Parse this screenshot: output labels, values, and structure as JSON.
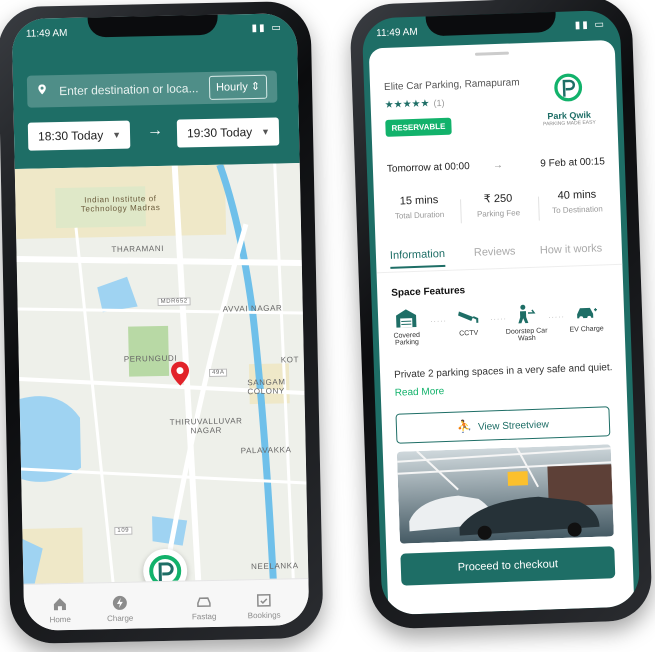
{
  "colors": {
    "brand": "#1e6e66",
    "accent_green": "#12b26b",
    "map_road": "#ffffff",
    "water": "#9fd3f2"
  },
  "phone_left": {
    "status_time": "11:49 AM",
    "search": {
      "placeholder": "Enter destination or loca...",
      "mode": "Hourly"
    },
    "start_time": "18:30 Today",
    "end_time": "19:30 Today",
    "arrow": "→",
    "map_labels": [
      "Indian Institute of Technology Madras",
      "THARAMANI",
      "PERUNGUDI",
      "AVVAI NAGAR",
      "SANGAM COLONY",
      "THIRUVALLUVAR NAGAR",
      "PALAVAKKA",
      "NEELANKA",
      "KOT",
      "MDR652",
      "109",
      "49A"
    ],
    "tabs": [
      {
        "label": "Home",
        "icon": "home-icon"
      },
      {
        "label": "Charge",
        "icon": "charge-icon"
      },
      {
        "label": "Fastag",
        "icon": "car-icon"
      },
      {
        "label": "Bookings",
        "icon": "calendar-check-icon"
      }
    ]
  },
  "phone_right": {
    "status_time": "11:49 AM",
    "title": "Elite Car Parking, Ramapuram",
    "rating_count": "(1)",
    "badge": "RESERVABLE",
    "brand": {
      "name": "Park Qwik",
      "tagline": "PARKING MADE EASY"
    },
    "from": "Tomorrow at 00:00",
    "to": "9 Feb at 00:15",
    "stats": [
      {
        "value": "15 mins",
        "label": "Total Duration"
      },
      {
        "value": "₹ 250",
        "label": "Parking Fee"
      },
      {
        "value": "40 mins",
        "label": "To Destination"
      }
    ],
    "tabs": [
      "Information",
      "Reviews",
      "How it works"
    ],
    "features_title": "Space Features",
    "features": [
      {
        "label": "Covered Parking",
        "icon": "garage-icon"
      },
      {
        "label": "CCTV",
        "icon": "cctv-icon"
      },
      {
        "label": "Doorstep Car Wash",
        "icon": "car-wash-icon"
      },
      {
        "label": "EV Charge",
        "icon": "ev-charge-icon"
      }
    ],
    "description": "Private 2 parking spaces in a very safe and quiet...",
    "read_more": "Read More",
    "streetview": "View Streetview",
    "checkout": "Proceed to checkout"
  }
}
